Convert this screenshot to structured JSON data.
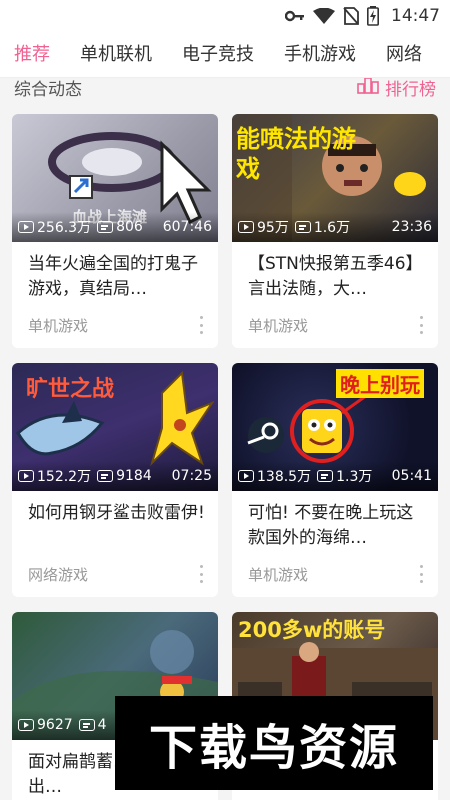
{
  "status_bar": {
    "time": "14:47",
    "icons": [
      "key-icon",
      "wifi-icon",
      "no-sim-icon",
      "battery-charging-icon"
    ]
  },
  "tabs": [
    {
      "label": "推荐",
      "active": true
    },
    {
      "label": "单机联机",
      "active": false
    },
    {
      "label": "电子竞技",
      "active": false
    },
    {
      "label": "手机游戏",
      "active": false
    },
    {
      "label": "网络",
      "active": false
    }
  ],
  "section": {
    "title": "综合动态",
    "ranking_label": "排行榜",
    "ranking_icon": "ranking-icon"
  },
  "cards": [
    {
      "plays": "256.3万",
      "danmaku": "806",
      "duration": "607:46",
      "title": "当年火遍全国的打鬼子游戏，真结局…",
      "category": "单机游戏",
      "thumb_text": "血战上海滩"
    },
    {
      "plays": "95万",
      "danmaku": "1.6万",
      "duration": "23:36",
      "title": "【STN快报第五季46】言出法随，大…",
      "category": "单机游戏",
      "thumb_text": "能喷法的游戏"
    },
    {
      "plays": "152.2万",
      "danmaku": "9184",
      "duration": "07:25",
      "title": "如何用钢牙鲨击败雷伊!",
      "category": "网络游戏",
      "thumb_text": "旷世之战"
    },
    {
      "plays": "138.5万",
      "danmaku": "1.3万",
      "duration": "05:41",
      "title": "可怕! 不要在晚上玩这款国外的海绵…",
      "category": "单机游戏",
      "thumb_text": "晚上别玩"
    },
    {
      "plays": "9627",
      "danmaku": "4",
      "duration": "",
      "title": "面对扁鹊蓄…你的小乔出…",
      "category": "",
      "thumb_text": ""
    },
    {
      "plays": "",
      "danmaku": "",
      "duration": "",
      "title": "",
      "category": "",
      "thumb_text": "200多w的账号"
    }
  ],
  "watermark": {
    "text": "下载鸟资源"
  },
  "colors": {
    "accent": "#f06292",
    "category_text": "#999999",
    "background": "#f4f4f4"
  }
}
